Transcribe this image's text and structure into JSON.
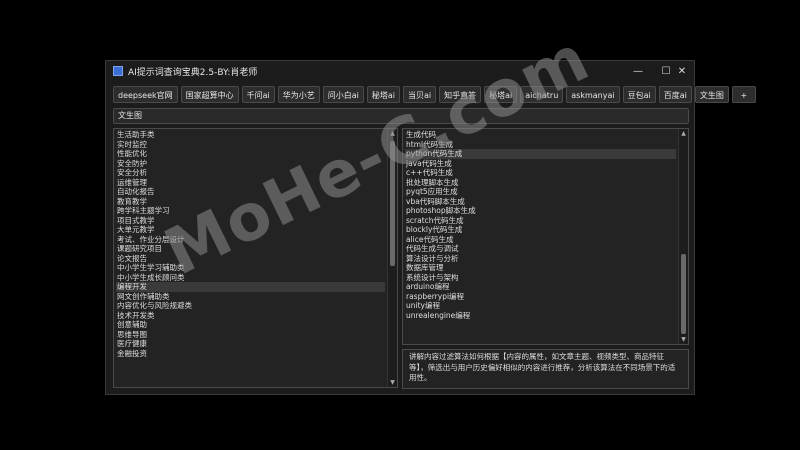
{
  "window": {
    "title": "AI提示词查询宝典2.5-BY:肖老师",
    "controls": {
      "minimize": "—",
      "maximize": "☐",
      "close": "✕"
    }
  },
  "tabs": [
    {
      "label": "deepseek官网"
    },
    {
      "label": "国家超算中心"
    },
    {
      "label": "千问ai"
    },
    {
      "label": "华为小艺"
    },
    {
      "label": "问小白ai"
    },
    {
      "label": "秘塔ai"
    },
    {
      "label": "当贝ai"
    },
    {
      "label": "知乎直答"
    },
    {
      "label": "秘塔ai"
    },
    {
      "label": "aichatru"
    },
    {
      "label": "askmanyai"
    },
    {
      "label": "豆包ai"
    },
    {
      "label": "百度ai"
    },
    {
      "label": "文生图"
    },
    {
      "label": "+"
    }
  ],
  "current_field": {
    "value": "文生图"
  },
  "left_list": {
    "items": [
      "生活助手类",
      "实时监控",
      "性能优化",
      "安全防护",
      "安全分析",
      "运维管理",
      "自动化报告",
      "教育教学",
      "跨学科主题学习",
      "项目式教学",
      "大单元教学",
      "考试、作业分层设计",
      "课题研究项目",
      "论文报告",
      "中小学生学习辅助类",
      "中小学生成长顾问类",
      "编程开发",
      "网文创作辅助类",
      "内容优化与风险规避类",
      "技术开发类",
      "创意辅助",
      "思维导图",
      "医疗健康",
      "金融投资"
    ],
    "selected_index": 16,
    "scroll_fraction": 0.5
  },
  "right_list": {
    "items": [
      "生成代码",
      "html代码生成",
      "python代码生成",
      "java代码生成",
      "c++代码生成",
      "批处理脚本生成",
      "pyqt5应用生成",
      "vba代码脚本生成",
      "photoshop脚本生成",
      "scratch代码生成",
      "blockly代码生成",
      "alice代码生成",
      "代码生成与调试",
      "算法设计与分析",
      "数据库管理",
      "系统设计与架构",
      "arduino编程",
      "raspberrypi编程",
      "unity编程",
      "unrealengine编程"
    ],
    "selected_index": 2,
    "scroll_fraction": 0.6
  },
  "description": {
    "text": "讲解内容过滤算法如何根据【内容的属性，如文章主题、视频类型、商品特征等】，筛选出与用户历史偏好相似的内容进行推荐，分析该算法在不同场景下的适用性。"
  },
  "watermark": {
    "text": "MoHe-C.com"
  },
  "colors": {
    "background": "#000000",
    "window": "#1c1c1c",
    "panel": "#232323",
    "text": "#dedede",
    "border": "#4a4a4a",
    "selected": "#3a3a3a"
  }
}
